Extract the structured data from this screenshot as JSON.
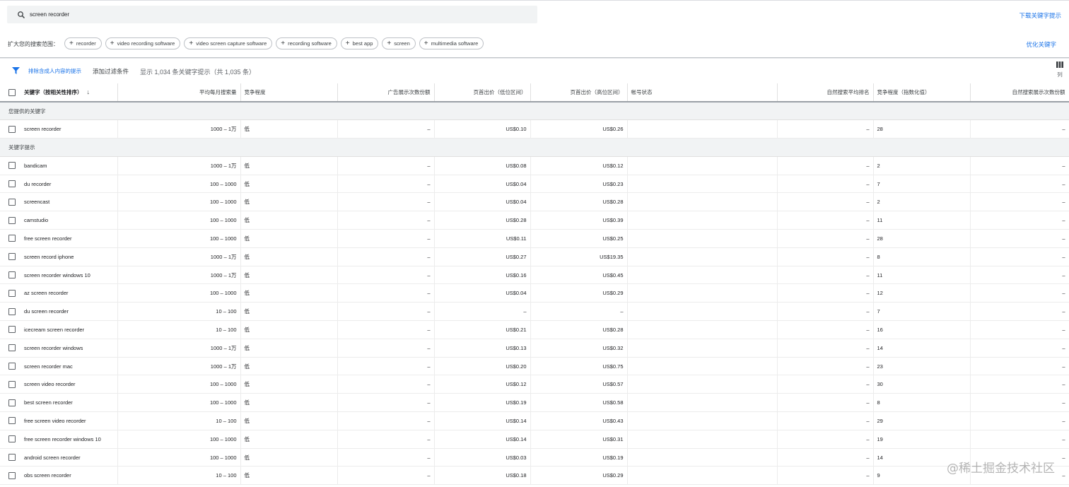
{
  "search": {
    "value": "screen recorder"
  },
  "download_label": "下载关键字提示",
  "expand": {
    "label": "扩大您的搜索范围：",
    "chips": [
      "recorder",
      "video recording software",
      "video screen capture software",
      "recording software",
      "best app",
      "screen",
      "multimedia software"
    ]
  },
  "refine_label": "优化关键字",
  "filter": {
    "exclude_label": "排除含成人内容的提示",
    "add_filter_label": "添加过滤条件",
    "result_text": "显示 1,034 条关键字提示（共 1,035 条）"
  },
  "columns_label": "列",
  "table": {
    "headers": {
      "keyword": "关键字（按相关性排序）",
      "avg_searches": "平均每月搜索量",
      "competition": "竞争程度",
      "impression_share": "广告展示次数份额",
      "bid_low": "页首出价（低位区间）",
      "bid_high": "页首出价（高位区间）",
      "account_status": "帐号状态",
      "organic_rank": "自然搜索平均排名",
      "competition_index": "竞争程度（指数化值）",
      "organic_impression_share": "自然搜索展示次数份额"
    },
    "provided_section": "您提供的关键字",
    "provided": [
      {
        "kw": "screen recorder",
        "avg": "1000 – 1万",
        "comp": "低",
        "share": "–",
        "low": "US$0.10",
        "high": "US$0.26",
        "status": "",
        "rank": "–",
        "index": "28",
        "organic": "–"
      }
    ],
    "ideas_section": "关键字提示",
    "ideas": [
      {
        "kw": "bandicam",
        "avg": "1000 – 1万",
        "comp": "低",
        "share": "–",
        "low": "US$0.08",
        "high": "US$0.12",
        "status": "",
        "rank": "–",
        "index": "2",
        "organic": "–"
      },
      {
        "kw": "du recorder",
        "avg": "100 – 1000",
        "comp": "低",
        "share": "–",
        "low": "US$0.04",
        "high": "US$0.23",
        "status": "",
        "rank": "–",
        "index": "7",
        "organic": "–"
      },
      {
        "kw": "screencast",
        "avg": "100 – 1000",
        "comp": "低",
        "share": "–",
        "low": "US$0.04",
        "high": "US$0.28",
        "status": "",
        "rank": "–",
        "index": "2",
        "organic": "–"
      },
      {
        "kw": "camstudio",
        "avg": "100 – 1000",
        "comp": "低",
        "share": "–",
        "low": "US$0.28",
        "high": "US$0.39",
        "status": "",
        "rank": "–",
        "index": "11",
        "organic": "–"
      },
      {
        "kw": "free screen recorder",
        "avg": "100 – 1000",
        "comp": "低",
        "share": "–",
        "low": "US$0.11",
        "high": "US$0.25",
        "status": "",
        "rank": "–",
        "index": "28",
        "organic": "–"
      },
      {
        "kw": "screen record iphone",
        "avg": "1000 – 1万",
        "comp": "低",
        "share": "–",
        "low": "US$0.27",
        "high": "US$19.35",
        "status": "",
        "rank": "–",
        "index": "8",
        "organic": "–"
      },
      {
        "kw": "screen recorder windows 10",
        "avg": "1000 – 1万",
        "comp": "低",
        "share": "–",
        "low": "US$0.16",
        "high": "US$0.45",
        "status": "",
        "rank": "–",
        "index": "11",
        "organic": "–"
      },
      {
        "kw": "az screen recorder",
        "avg": "100 – 1000",
        "comp": "低",
        "share": "–",
        "low": "US$0.04",
        "high": "US$0.29",
        "status": "",
        "rank": "–",
        "index": "12",
        "organic": "–"
      },
      {
        "kw": "du screen recorder",
        "avg": "10 – 100",
        "comp": "低",
        "share": "–",
        "low": "–",
        "high": "–",
        "status": "",
        "rank": "–",
        "index": "7",
        "organic": "–"
      },
      {
        "kw": "icecream screen recorder",
        "avg": "10 – 100",
        "comp": "低",
        "share": "–",
        "low": "US$0.21",
        "high": "US$0.28",
        "status": "",
        "rank": "–",
        "index": "16",
        "organic": "–"
      },
      {
        "kw": "screen recorder windows",
        "avg": "1000 – 1万",
        "comp": "低",
        "share": "–",
        "low": "US$0.13",
        "high": "US$0.32",
        "status": "",
        "rank": "–",
        "index": "14",
        "organic": "–"
      },
      {
        "kw": "screen recorder mac",
        "avg": "1000 – 1万",
        "comp": "低",
        "share": "–",
        "low": "US$0.20",
        "high": "US$0.75",
        "status": "",
        "rank": "–",
        "index": "23",
        "organic": "–"
      },
      {
        "kw": "screen video recorder",
        "avg": "100 – 1000",
        "comp": "低",
        "share": "–",
        "low": "US$0.12",
        "high": "US$0.57",
        "status": "",
        "rank": "–",
        "index": "30",
        "organic": "–"
      },
      {
        "kw": "best screen recorder",
        "avg": "100 – 1000",
        "comp": "低",
        "share": "–",
        "low": "US$0.19",
        "high": "US$0.58",
        "status": "",
        "rank": "–",
        "index": "8",
        "organic": "–"
      },
      {
        "kw": "free screen video recorder",
        "avg": "10 – 100",
        "comp": "低",
        "share": "–",
        "low": "US$0.14",
        "high": "US$0.43",
        "status": "",
        "rank": "–",
        "index": "29",
        "organic": "–"
      },
      {
        "kw": "free screen recorder windows 10",
        "avg": "100 – 1000",
        "comp": "低",
        "share": "–",
        "low": "US$0.14",
        "high": "US$0.31",
        "status": "",
        "rank": "–",
        "index": "19",
        "organic": "–"
      },
      {
        "kw": "android screen recorder",
        "avg": "100 – 1000",
        "comp": "低",
        "share": "–",
        "low": "US$0.03",
        "high": "US$0.19",
        "status": "",
        "rank": "–",
        "index": "14",
        "organic": "–"
      },
      {
        "kw": "obs screen recorder",
        "avg": "10 – 100",
        "comp": "低",
        "share": "–",
        "low": "US$0.18",
        "high": "US$0.29",
        "status": "",
        "rank": "–",
        "index": "9",
        "organic": "–"
      }
    ]
  },
  "watermark": "@稀土掘金技术社区",
  "colors": {
    "accent": "#1a73e8",
    "section_bg": "#f1f3f4",
    "search_bg": "#f1f3f4"
  },
  "icons": {
    "search": "search-icon",
    "filter": "filter-icon",
    "columns": "columns-icon",
    "plus": "plus-icon",
    "sort": "arrow-down-icon"
  }
}
